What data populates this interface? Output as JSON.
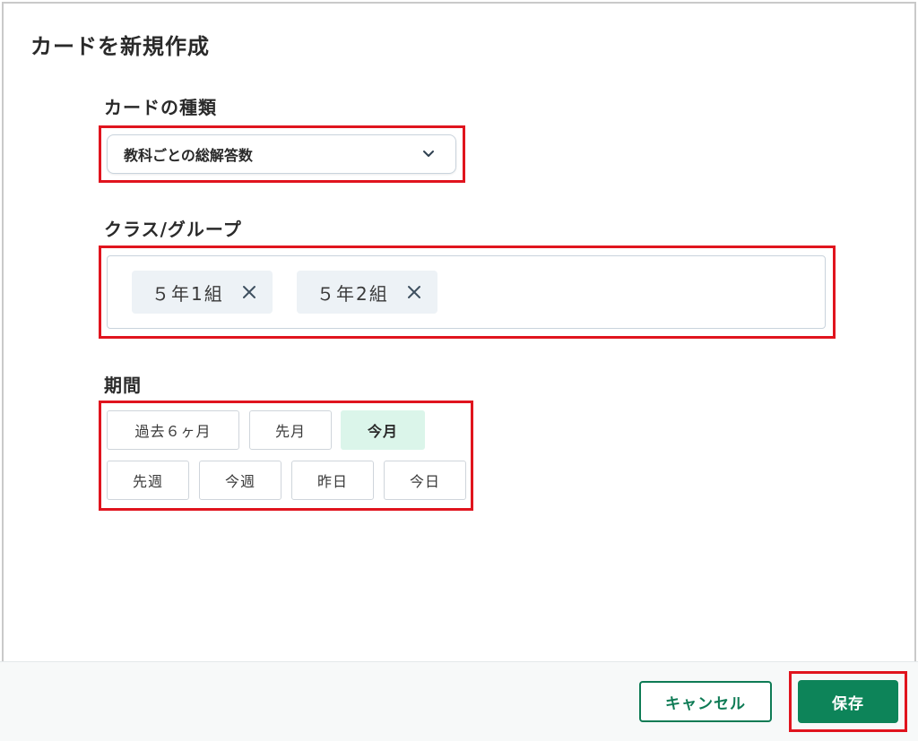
{
  "dialog": {
    "title": "カードを新規作成"
  },
  "card_type": {
    "label": "カードの種類",
    "selected": "教科ごとの総解答数"
  },
  "class_group": {
    "label": "クラス/グループ",
    "tags": [
      "５年1組",
      "５年2組"
    ]
  },
  "period": {
    "label": "期間",
    "options": [
      "過去６ヶ月",
      "先月",
      "今月",
      "先週",
      "今週",
      "昨日",
      "今日"
    ],
    "selected": "今月"
  },
  "footer": {
    "cancel_label": "キャンセル",
    "save_label": "保存"
  },
  "colors": {
    "primary": "#0d8459",
    "highlight": "#e0141e",
    "selected_bg": "#dbf5ea"
  },
  "icons": {
    "select_chevron": "chevron-down-icon",
    "tag_remove": "close-icon"
  }
}
